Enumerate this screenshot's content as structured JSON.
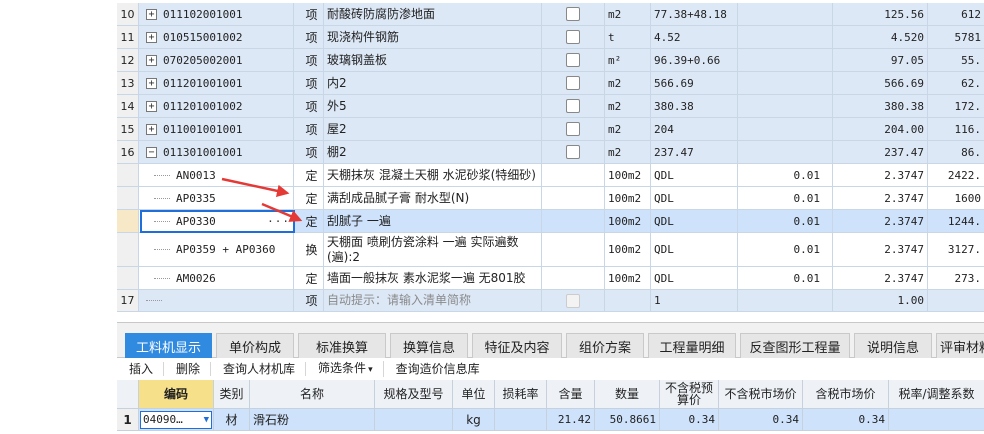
{
  "bill_rows": [
    {
      "num": "10",
      "expander": "+",
      "code": "011102001001",
      "type": "项",
      "name": "耐酸砖防腐防渗地面",
      "unit": "m2",
      "expr": "77.38+48.18",
      "qty": "125.56",
      "price": "612"
    },
    {
      "num": "11",
      "expander": "+",
      "code": "010515001002",
      "type": "项",
      "name": "现浇构件钢筋",
      "unit": "t",
      "expr": "4.52",
      "qty": "4.520",
      "price": "5781"
    },
    {
      "num": "12",
      "expander": "+",
      "code": "070205002001",
      "type": "项",
      "name": "玻璃钢盖板",
      "unit": "m²",
      "expr": "96.39+0.66",
      "qty": "97.05",
      "price": "55."
    },
    {
      "num": "13",
      "expander": "+",
      "code": "011201001001",
      "type": "项",
      "name": "内2",
      "unit": "m2",
      "expr": "566.69",
      "qty": "566.69",
      "price": "62."
    },
    {
      "num": "14",
      "expander": "+",
      "code": "011201001002",
      "type": "项",
      "name": "外5",
      "unit": "m2",
      "expr": "380.38",
      "qty": "380.38",
      "price": "172."
    },
    {
      "num": "15",
      "expander": "+",
      "code": "011001001001",
      "type": "项",
      "name": "屋2",
      "unit": "m2",
      "expr": "204",
      "qty": "204.00",
      "price": "116."
    },
    {
      "num": "16",
      "expander": "−",
      "code": "011301001001",
      "type": "项",
      "name": "棚2",
      "unit": "m2",
      "expr": "237.47",
      "qty": "237.47",
      "price": "86."
    }
  ],
  "quota_rows": [
    {
      "code": "AN0013",
      "type": "定",
      "name": "天棚抹灰 混凝土天棚 水泥砂浆(特细砂)",
      "unit": "100m2",
      "expr": "QDL",
      "coef": "0.01",
      "qty": "2.3747",
      "price": "2422."
    },
    {
      "code": "AP0335",
      "type": "定",
      "name": "满刮成品腻子膏 耐水型(N)",
      "unit": "100m2",
      "expr": "QDL",
      "coef": "0.01",
      "qty": "2.3747",
      "price": "1600"
    },
    {
      "code": "AP0330",
      "type": "定",
      "name": "刮腻子 一遍",
      "unit": "100m2",
      "expr": "QDL",
      "coef": "0.01",
      "qty": "2.3747",
      "price": "1244.",
      "dots": "···"
    },
    {
      "code": "AP0359 + AP0360",
      "type": "换",
      "name": "天棚面 喷刷仿瓷涂料 一遍  实际遍数(遍):2",
      "unit": "100m2",
      "expr": "QDL",
      "coef": "0.01",
      "qty": "2.3747",
      "price": "3127."
    },
    {
      "code": "AM0026",
      "type": "定",
      "name": "墙面一般抹灰 素水泥浆一遍 无801胶",
      "unit": "100m2",
      "expr": "QDL",
      "coef": "0.01",
      "qty": "2.3747",
      "price": "273."
    }
  ],
  "prompt_row": {
    "num": "17",
    "type": "项",
    "hint": "自动提示：请输入清单简称",
    "expr": "1",
    "qty": "1.00"
  },
  "tabs": [
    "工料机显示",
    "单价构成",
    "标准换算",
    "换算信息",
    "特征及内容",
    "组价方案",
    "工程量明细",
    "反查图形工程量",
    "说明信息",
    "评审材料"
  ],
  "toolbar": [
    "插入",
    "删除",
    "查询人材机库",
    "筛选条件",
    "查询造价信息库"
  ],
  "lower_headers": [
    "编码",
    "类别",
    "名称",
    "规格及型号",
    "单位",
    "损耗率",
    "含量",
    "数量",
    "不含税预算价",
    "不含税市场价",
    "含税市场价",
    "税率/调整系数"
  ],
  "lower_row": {
    "idx": "1",
    "code": "04090…",
    "type": "材",
    "name": "滑石粉",
    "spec": "",
    "unit": "kg",
    "loss": "",
    "content": "21.42",
    "qty": "50.8661",
    "budget": "0.34",
    "market": "0.34",
    "market_tax": "0.34",
    "rate": ""
  },
  "colors": {
    "active_tab": "#2f8ae0",
    "bill_row_bg": "#dde8f7",
    "selected_row_bg": "#cfe2fb",
    "arrow": "#e53935",
    "header_highlight": "#f7e08a"
  }
}
